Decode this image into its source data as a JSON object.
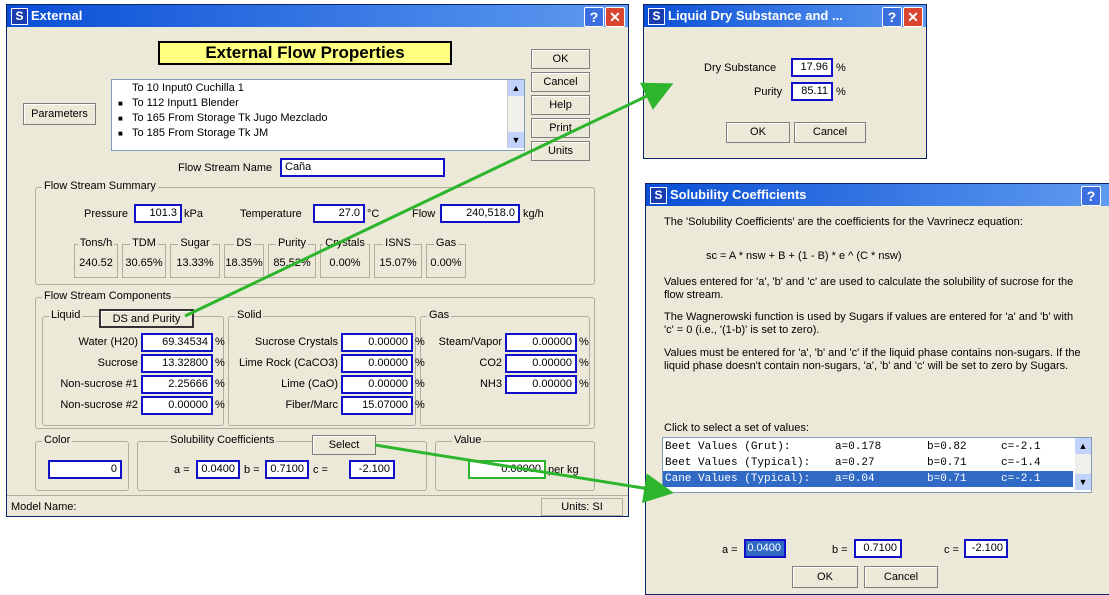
{
  "ext": {
    "title": "External",
    "heading": "External Flow Properties",
    "buttons": {
      "ok": "OK",
      "cancel": "Cancel",
      "help": "Help",
      "print": "Print",
      "units": "Units"
    },
    "parameters_btn": "Parameters",
    "list": [
      {
        "bullet": "",
        "text": "To  10 Input0 Cuchilla 1"
      },
      {
        "bullet": "■",
        "text": "To  112 Input1 Blender"
      },
      {
        "bullet": "■",
        "text": "To  165 From Storage Tk Jugo Mezclado"
      },
      {
        "bullet": "■",
        "text": "To  185 From Storage Tk JM"
      }
    ],
    "stream_name_label": "Flow Stream Name",
    "stream_name": "Caña",
    "summary": {
      "title": "Flow Stream Summary",
      "pressure_label": "Pressure",
      "pressure": "101.3",
      "pressure_unit": "kPa",
      "temp_label": "Temperature",
      "temp": "27.0",
      "temp_unit": "°C",
      "flow_label": "Flow",
      "flow": "240,518.0",
      "flow_unit": "kg/h",
      "cells": [
        {
          "h": "Tons/h",
          "v": "240.52"
        },
        {
          "h": "TDM",
          "v": "30.65%"
        },
        {
          "h": "Sugar",
          "v": "13.33%"
        },
        {
          "h": "DS",
          "v": "18.35%"
        },
        {
          "h": "Purity",
          "v": "85.52%"
        },
        {
          "h": "Crystals",
          "v": "0.00%"
        },
        {
          "h": "ISNS",
          "v": "15.07%"
        },
        {
          "h": "Gas",
          "v": "0.00%"
        }
      ]
    },
    "components": {
      "title": "Flow Stream Components",
      "liquid_title": "Liquid",
      "ds_btn": "DS and Purity",
      "solid_title": "Solid",
      "gas_title": "Gas",
      "liquid": [
        {
          "label": "Water (H20)",
          "value": "69.34534",
          "unit": "%"
        },
        {
          "label": "Sucrose",
          "value": "13.32800",
          "unit": "%"
        },
        {
          "label": "Non-sucrose #1",
          "value": "2.25666",
          "unit": "%"
        },
        {
          "label": "Non-sucrose #2",
          "value": "0.00000",
          "unit": "%"
        }
      ],
      "solid": [
        {
          "label": "Sucrose Crystals",
          "value": "0.00000",
          "unit": "%"
        },
        {
          "label": "Lime Rock (CaCO3)",
          "value": "0.00000",
          "unit": "%"
        },
        {
          "label": "Lime (CaO)",
          "value": "0.00000",
          "unit": "%"
        },
        {
          "label": "Fiber/Marc",
          "value": "15.07000",
          "unit": "%"
        }
      ],
      "gas": [
        {
          "label": "Steam/Vapor",
          "value": "0.00000",
          "unit": "%"
        },
        {
          "label": "CO2",
          "value": "0.00000",
          "unit": "%"
        },
        {
          "label": "NH3",
          "value": "0.00000",
          "unit": "%"
        }
      ]
    },
    "color_title": "Color",
    "color_value": "0",
    "sol_title": "Solubility Coefficients",
    "select_btn": "Select",
    "a_label": "a =",
    "a": "0.0400",
    "b_label": "b =",
    "b": "0.7100",
    "c_label": "c =",
    "c": "-2.100",
    "value_title": "Value",
    "value": "0.00000",
    "value_unit": "per kg",
    "status_model": "Model Name:",
    "status_units": "Units: SI"
  },
  "lds": {
    "title": "Liquid Dry Substance and ...",
    "ds_label": "Dry Substance",
    "ds": "17.96",
    "ds_unit": "%",
    "purity_label": "Purity",
    "purity": "85.11",
    "purity_unit": "%",
    "ok": "OK",
    "cancel": "Cancel"
  },
  "sol": {
    "title": "Solubility Coefficients",
    "p1": "The 'Solubility Coefficients' are the coefficients for the Vavrinecz equation:",
    "eq": "sc = A * nsw + B + (1 - B) * e ^ (C * nsw)",
    "p2": "Values entered for 'a',  'b' and 'c' are used to calculate the solubility of sucrose for the flow stream.",
    "p3": "The Wagnerowski function is used by Sugars if values are entered for 'a' and 'b' with 'c' = 0 (i.e., '(1-b)' is set to zero).",
    "p4": "Values must be entered for 'a', 'b' and 'c' if the liquid phase contains non-sugars. If the liquid phase doesn't contain non-sugars, 'a', 'b' and 'c' will be set to zero by Sugars.",
    "click": "Click to select a set of values:",
    "rows": [
      {
        "name": "Beet Values (Grut):",
        "a": "a=0.178",
        "b": "b=0.82",
        "c": "c=-2.1"
      },
      {
        "name": "Beet Values (Typical):",
        "a": "a=0.27",
        "b": "b=0.71",
        "c": "c=-1.4"
      },
      {
        "name": "Cane Values (Typical):",
        "a": "a=0.04",
        "b": "b=0.71",
        "c": "c=-2.1"
      }
    ],
    "a_label": "a =",
    "a": "0.0400",
    "b_label": "b =",
    "b": "0.7100",
    "c_label": "c =",
    "c": "-2.100",
    "ok": "OK",
    "cancel": "Cancel"
  },
  "colors": {
    "arrow": "#2db52d",
    "field_border": "#1010c8",
    "selection": "#316ac5",
    "heading_bg": "#ffff80"
  }
}
